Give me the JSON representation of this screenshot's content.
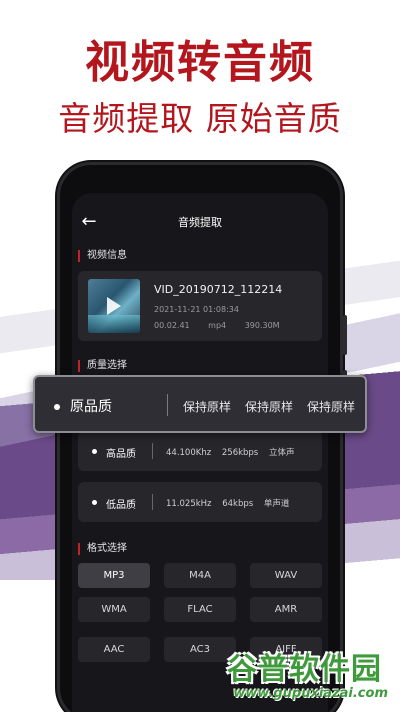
{
  "promo": {
    "headline": "视频转音频",
    "subheadline": "音频提取 原始音质"
  },
  "header": {
    "back_icon": "back-arrow-icon",
    "title": "音频提取"
  },
  "video_info": {
    "section_title": "视频信息",
    "filename": "VID_20190712_112214",
    "datetime": "2021-11-21 01:08:34",
    "duration": "00.02.41",
    "format": "mp4",
    "size": "390.30M"
  },
  "quality": {
    "section_title": "质量选择",
    "selected": {
      "label": "原品质",
      "options": [
        "保持原样",
        "保持原样",
        "保持原样"
      ]
    },
    "rows": [
      {
        "label": "高品质",
        "sample_rate": "44.100Khz",
        "bitrate": "256kbps",
        "channel": "立体声"
      },
      {
        "label": "低品质",
        "sample_rate": "11.025kHz",
        "bitrate": "64kbps",
        "channel": "单声道"
      }
    ]
  },
  "format": {
    "section_title": "格式选择",
    "options": [
      "MP3",
      "M4A",
      "WAV",
      "WMA",
      "FLAC",
      "AMR",
      "AAC",
      "AC3",
      "AIFF"
    ],
    "selected": "MP3"
  },
  "watermark": {
    "title": "谷普软件园",
    "url": "www.gupuxiazai.com"
  },
  "colors": {
    "accent_red": "#b3161c",
    "screen_bg": "#17171b",
    "card_bg": "#26262b",
    "watermark_green": "#3f9a3c"
  }
}
